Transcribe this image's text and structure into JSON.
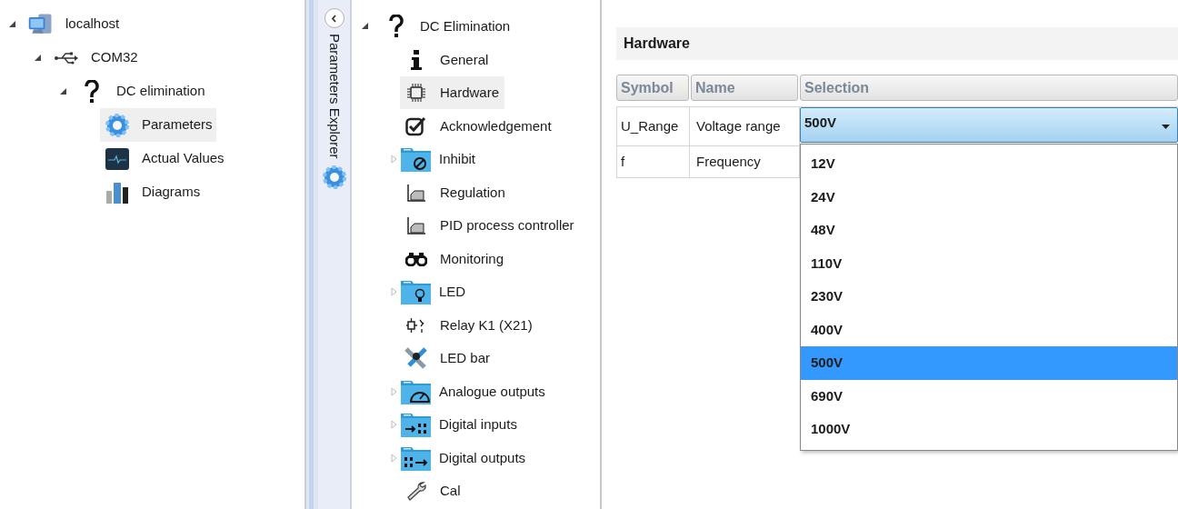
{
  "device_tree": [
    {
      "label": "localhost",
      "kind": "computer",
      "expanded": true,
      "selected": false,
      "children": [
        {
          "label": "COM32",
          "kind": "usb",
          "expanded": true,
          "selected": false,
          "children": [
            {
              "label": "DC elimination",
              "kind": "question",
              "expanded": true,
              "selected": false,
              "children": [
                {
                  "label": "Parameters",
                  "kind": "gear",
                  "selected": true
                },
                {
                  "label": "Actual Values",
                  "kind": "monitor",
                  "selected": false
                },
                {
                  "label": "Diagrams",
                  "kind": "bars",
                  "selected": false
                }
              ]
            }
          ]
        }
      ]
    }
  ],
  "side_strip": {
    "title": "Parameters Explorer"
  },
  "parameter_tree": {
    "label": "DC Elimination",
    "kind": "question",
    "expanded": true,
    "children": [
      {
        "label": "General",
        "kind": "info",
        "selected": false
      },
      {
        "label": "Hardware",
        "kind": "chip",
        "selected": true
      },
      {
        "label": "Acknowledgement",
        "kind": "check",
        "selected": false
      },
      {
        "label": "Inhibit",
        "kind": "folder-block",
        "expanded": false,
        "selected": false
      },
      {
        "label": "Regulation",
        "kind": "curve",
        "selected": false
      },
      {
        "label": "PID process controller",
        "kind": "curve",
        "selected": false
      },
      {
        "label": "Monitoring",
        "kind": "binoculars",
        "selected": false
      },
      {
        "label": "LED",
        "kind": "folder-bulb",
        "expanded": false,
        "selected": false
      },
      {
        "label": "Relay K1 (X21)",
        "kind": "relay",
        "selected": false
      },
      {
        "label": "LED bar",
        "kind": "tools",
        "selected": false
      },
      {
        "label": "Analogue outputs",
        "kind": "folder-gauge",
        "expanded": false,
        "selected": false
      },
      {
        "label": "Digital inputs",
        "kind": "folder-in",
        "expanded": false,
        "selected": false
      },
      {
        "label": "Digital outputs",
        "kind": "folder-out",
        "expanded": false,
        "selected": false
      },
      {
        "label": "Cal",
        "kind": "wrench",
        "selected": false
      }
    ]
  },
  "hardware": {
    "title": "Hardware",
    "columns": [
      "Symbol",
      "Name",
      "Selection"
    ],
    "rows": [
      {
        "symbol": "U_Range",
        "name": "Voltage range",
        "selection": "500V"
      },
      {
        "symbol": "f",
        "name": "Frequency"
      }
    ],
    "dropdown": {
      "open": true,
      "options": [
        {
          "label": "12V",
          "selected": false
        },
        {
          "label": "24V",
          "selected": false
        },
        {
          "label": "48V",
          "selected": false
        },
        {
          "label": "110V",
          "selected": false
        },
        {
          "label": "230V",
          "selected": false
        },
        {
          "label": "400V",
          "selected": false
        },
        {
          "label": "500V",
          "selected": true
        },
        {
          "label": "690V",
          "selected": false
        },
        {
          "label": "1000V",
          "selected": false
        }
      ]
    }
  }
}
